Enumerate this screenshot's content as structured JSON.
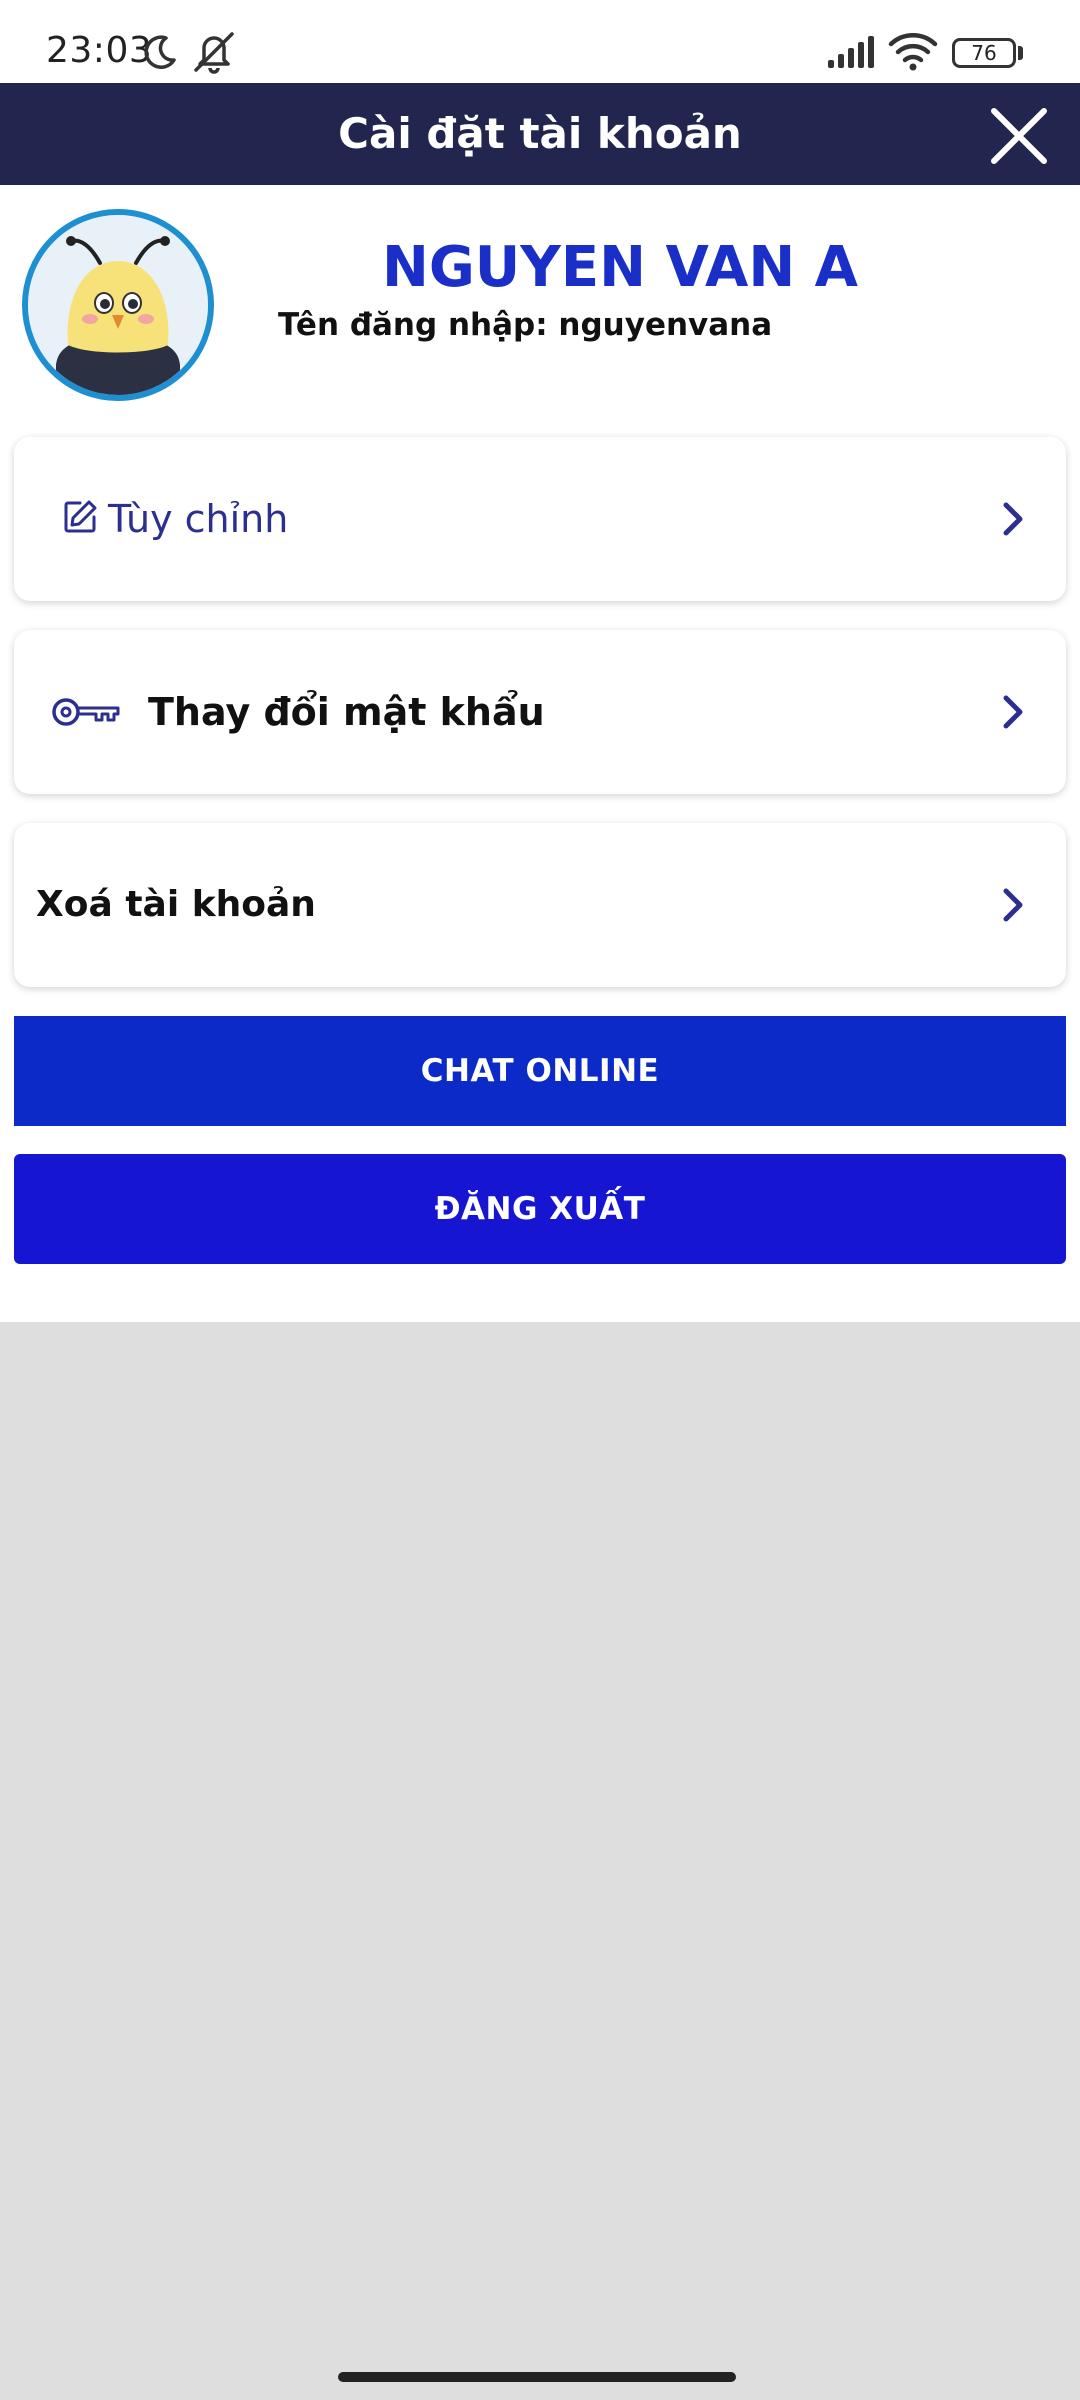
{
  "status_bar": {
    "time": "23:03",
    "battery": "76",
    "icons": [
      "moon-icon",
      "mute-icon",
      "signal-icon",
      "wifi-icon",
      "battery-icon"
    ]
  },
  "header": {
    "title": "Cài đặt tài khoản",
    "close_icon": "close-icon",
    "background": "#22264e"
  },
  "profile": {
    "name": "NGUYEN VAN A",
    "login": "Tên đăng nhập: nguyenvana"
  },
  "menu": [
    {
      "label": "Tùy chỉnh",
      "icon": "edit-icon"
    },
    {
      "label": "Thay đổi mật khẩu",
      "icon": "key-icon"
    },
    {
      "label": "Xoá tài khoản",
      "icon": ""
    }
  ],
  "buttons": {
    "chat": "CHAT ONLINE",
    "logout": "ĐĂNG XUẤT"
  },
  "colors": {
    "accent": "#1a2fc7",
    "chat_button": "#0b2ac8",
    "logout_button": "#1616d2",
    "background": "#dedede"
  }
}
